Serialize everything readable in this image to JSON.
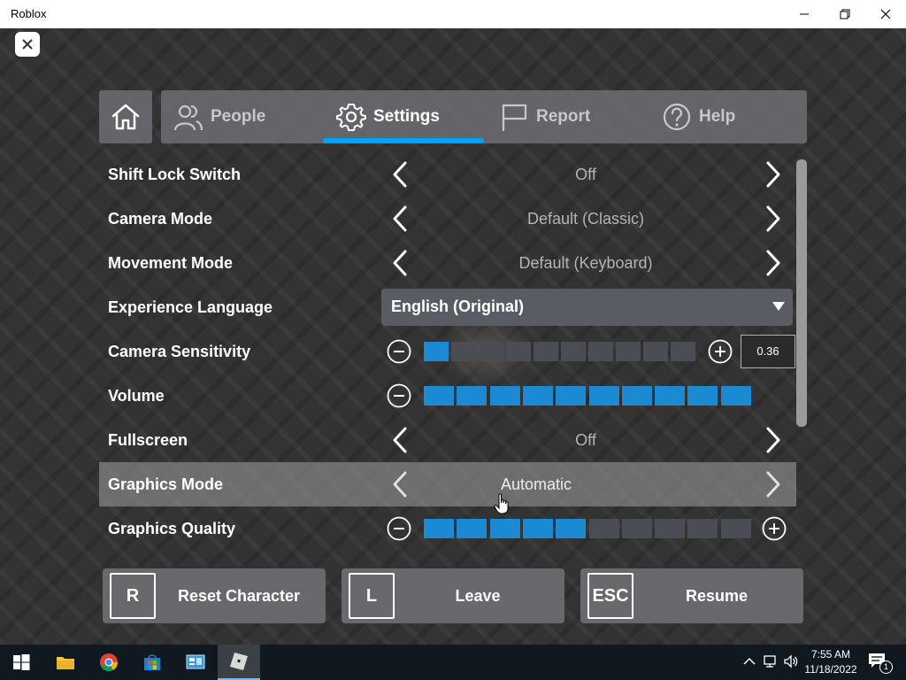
{
  "window": {
    "title": "Roblox"
  },
  "tabs": [
    {
      "label": "People",
      "icon": "people-icon"
    },
    {
      "label": "Settings",
      "icon": "gear-icon"
    },
    {
      "label": "Report",
      "icon": "flag-icon"
    },
    {
      "label": "Help",
      "icon": "question-icon"
    }
  ],
  "settings": {
    "shift_lock": {
      "label": "Shift Lock Switch",
      "value": "Off"
    },
    "camera_mode": {
      "label": "Camera Mode",
      "value": "Default (Classic)"
    },
    "movement_mode": {
      "label": "Movement Mode",
      "value": "Default (Keyboard)"
    },
    "experience_language": {
      "label": "Experience Language",
      "value": "English (Original)"
    },
    "camera_sensitivity": {
      "label": "Camera Sensitivity",
      "value": "0.36",
      "level": 1,
      "max": 10
    },
    "volume": {
      "label": "Volume",
      "level": 10,
      "max": 10
    },
    "fullscreen": {
      "label": "Fullscreen",
      "value": "Off"
    },
    "graphics_mode": {
      "label": "Graphics Mode",
      "value": "Automatic"
    },
    "graphics_quality": {
      "label": "Graphics Quality",
      "level": 5,
      "max": 10
    }
  },
  "actions": {
    "reset": {
      "key": "R",
      "label": "Reset Character"
    },
    "leave": {
      "key": "L",
      "label": "Leave"
    },
    "resume": {
      "key": "ESC",
      "label": "Resume"
    }
  },
  "taskbar": {
    "time": "7:55 AM",
    "date": "11/18/2022",
    "notification_count": "1"
  },
  "colors": {
    "accent": "#00a2ff",
    "slider_on": "#1b8ad3",
    "slider_off": "#4a4d53"
  }
}
